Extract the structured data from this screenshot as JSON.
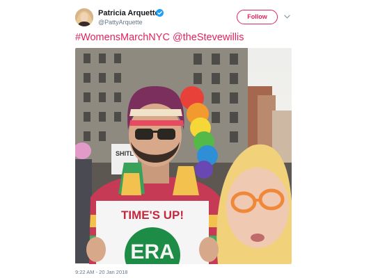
{
  "tweet": {
    "display_name": "Patricia Arquette",
    "handle": "@PattyArquette",
    "follow_label": "Follow",
    "text": "#WomensMarchNYC @theStevewillis",
    "timestamp": "9:22 AM - 20 Jan 2018",
    "accent_color": "#e0245e",
    "verified_color": "#1da1f2"
  },
  "photo": {
    "sign_top_text": "TIME'S UP!",
    "sign_logo_text": "ERA",
    "partial_sign_text": "SHITL"
  }
}
